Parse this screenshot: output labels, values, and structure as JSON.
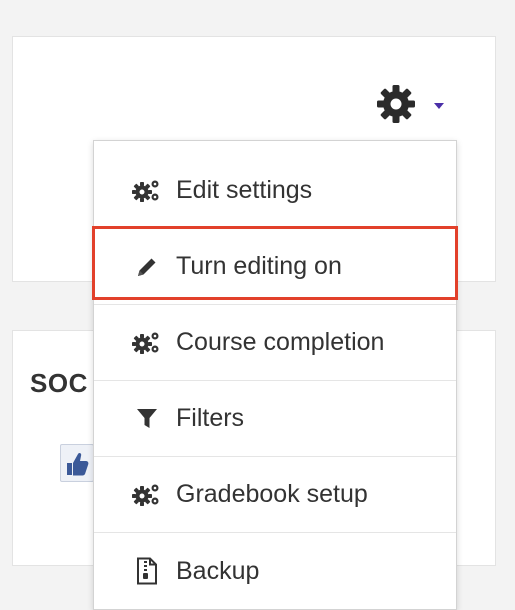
{
  "block": {
    "title": "SOC"
  },
  "menu": {
    "items": [
      {
        "label": "Edit settings",
        "icon": "cogs-icon"
      },
      {
        "label": "Turn editing on",
        "icon": "pencil-icon"
      },
      {
        "label": "Course completion",
        "icon": "cogs-icon"
      },
      {
        "label": "Filters",
        "icon": "filter-icon"
      },
      {
        "label": "Gradebook setup",
        "icon": "cogs-icon"
      },
      {
        "label": "Backup",
        "icon": "file-archive-icon"
      }
    ]
  },
  "colors": {
    "highlight": "#e2402a",
    "caret": "#4a2fa8",
    "text": "#333333"
  }
}
